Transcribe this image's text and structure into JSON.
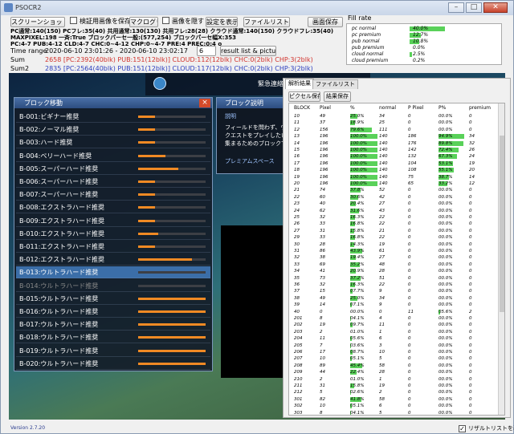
{
  "window": {
    "title": "PSOCR2",
    "min": "–",
    "max": "□",
    "close": "✕"
  },
  "toolbar": {
    "screenshot_btn": "スクリーンショット解析",
    "save_check": "検証用画像を保存",
    "macro_btn": "マクログリア",
    "hide_check": "画像を隠す",
    "settings_btn": "設定を表示",
    "clear_btn": "ファイルリストをクリア",
    "save_img_btn": "画面保存"
  },
  "info_lines": [
    "PC通常:140(150) PCフレ:35(40) 共用通常:130(130) 共用フレ:28(28) クラウド通常:140(150) クラウドフレ:35(40)",
    "MAXPIXEL:198 一斉:True ブロックパーセ一般:(577,254) ブロックパーセ幅X:353",
    "PC:4-7 PUB:4-12 CLD:4-7 CHC:0~4-12 CHP:0~4-7 PRE:4 PREC:0:4 o"
  ],
  "time_range": {
    "label": "Time range",
    "value": "2020-06-10 23:01:26 - 2020-06-10 23:02:17",
    "count": "6",
    "button": "result list & picture"
  },
  "sum": {
    "label": "Sum",
    "value": "2658 [PC:2392(40blk) PUB:151(12blk)] CLOUD:112(12blk) CHC:0(2blk) CHP:3(2blk)"
  },
  "sum2": {
    "label": "Sum2",
    "value": "2835 [PC:2564(40blk) PUB:151(12blk)] CLOUD:117(12blk) CHC:0(2blk) CHP:3(2blk)"
  },
  "fill_rate": {
    "title": "Fill rate",
    "rows": [
      {
        "name": "pc normal",
        "value": "40.0%",
        "fill": 0.4
      },
      {
        "name": "pc premium",
        "value": "12.7%",
        "fill": 0.127
      },
      {
        "name": "pub normal",
        "value": "10.8%",
        "fill": 0.108
      },
      {
        "name": "pub premium",
        "value": "0.0%",
        "fill": 0.0
      },
      {
        "name": "cloud normal",
        "value": "2.5%",
        "fill": 0.025
      },
      {
        "name": "cloud premium",
        "value": "0.2%",
        "fill": 0.002
      }
    ]
  },
  "block_window": {
    "title": "ブロック移動",
    "rows": [
      {
        "name": "B-001:ビギナー推奨",
        "bar": 0.25
      },
      {
        "name": "B-002:ノーマル推奨",
        "bar": 0.25
      },
      {
        "name": "B-003:ハード推奨",
        "bar": 0.25
      },
      {
        "name": "B-004:ベリーハード推奨",
        "bar": 0.4
      },
      {
        "name": "B-005:スーパーハード推奨",
        "bar": 0.6
      },
      {
        "name": "B-006:スーパーハード推奨",
        "bar": 0.25
      },
      {
        "name": "B-007:スーパーハード推奨",
        "bar": 0.25
      },
      {
        "name": "B-008:エクストラハード推奨",
        "bar": 0.25
      },
      {
        "name": "B-009:エクストラハード推奨",
        "bar": 0.25
      },
      {
        "name": "B-010:エクストラハード推奨",
        "bar": 0.3
      },
      {
        "name": "B-011:エクストラハード推奨",
        "bar": 0.25
      },
      {
        "name": "B-012:エクストラハード推奨",
        "bar": 0.8
      },
      {
        "name": "B-013:ウルトラハード推奨",
        "bar": 0.0
      },
      {
        "name": "B-014:ウルトラハード推奨",
        "bar": 0.0
      },
      {
        "name": "B-015:ウルトラハード推奨",
        "bar": 1.0
      },
      {
        "name": "B-016:ウルトラハード推奨",
        "bar": 1.0
      },
      {
        "name": "B-017:ウルトラハード推奨",
        "bar": 1.0
      },
      {
        "name": "B-018:ウルトラハード推奨",
        "bar": 1.0
      },
      {
        "name": "B-019:ウルトラハード推奨",
        "bar": 1.0
      },
      {
        "name": "B-020:ウルトラハード推奨",
        "bar": 1.0
      }
    ]
  },
  "explain_window": {
    "title": "ブロック説明",
    "section": "説明",
    "lines": [
      "フィールドを問わず、ウル",
      "クエストをプレイしたい",
      "集まるためのブロックで"
    ],
    "footer": "プレミアムスペース"
  },
  "hud": {
    "urgent": "緊急連絡"
  },
  "result_panel": {
    "tab1": "解析結果",
    "tab2": "ファイルリスト",
    "clip_btn": "ピクセル保存",
    "save_btn": "結果保存",
    "headers": [
      "BLOCK",
      "Pixel",
      "%",
      "normal",
      "P Pixel",
      "P%",
      "premium"
    ],
    "rows": [
      [
        "10",
        "49",
        "25.0%",
        "34",
        "0",
        "00.0%",
        "0"
      ],
      [
        "11",
        "37",
        "18.9%",
        "25",
        "0",
        "00.0%",
        "0"
      ],
      [
        "12",
        "156",
        "79.6%",
        "111",
        "0",
        "00.0%",
        "0"
      ],
      [
        "13",
        "196",
        "100.0%",
        "140",
        "186",
        "94.9%",
        "34"
      ],
      [
        "14",
        "196",
        "100.0%",
        "140",
        "176",
        "89.8%",
        "32"
      ],
      [
        "15",
        "196",
        "100.0%",
        "140",
        "142",
        "72.4%",
        "26"
      ],
      [
        "16",
        "196",
        "100.0%",
        "140",
        "132",
        "67.3%",
        "24"
      ],
      [
        "17",
        "196",
        "100.0%",
        "140",
        "104",
        "53.1%",
        "19"
      ],
      [
        "18",
        "196",
        "100.0%",
        "140",
        "108",
        "55.1%",
        "20"
      ],
      [
        "19",
        "196",
        "100.0%",
        "140",
        "75",
        "38.7%",
        "14"
      ],
      [
        "20",
        "196",
        "100.0%",
        "140",
        "65",
        "33.2%",
        "12"
      ],
      [
        "21",
        "74",
        "37.8%",
        "52",
        "0",
        "00.0%",
        "0"
      ],
      [
        "22",
        "60",
        "30.6%",
        "42",
        "0",
        "00.0%",
        "0"
      ],
      [
        "23",
        "40",
        "20.4%",
        "27",
        "0",
        "00.0%",
        "0"
      ],
      [
        "24",
        "62",
        "31.6%",
        "43",
        "0",
        "00.0%",
        "0"
      ],
      [
        "25",
        "32",
        "16.3%",
        "22",
        "0",
        "00.0%",
        "0"
      ],
      [
        "26",
        "33",
        "16.8%",
        "22",
        "0",
        "00.0%",
        "0"
      ],
      [
        "27",
        "31",
        "15.8%",
        "21",
        "0",
        "00.0%",
        "0"
      ],
      [
        "29",
        "33",
        "16.8%",
        "22",
        "0",
        "00.0%",
        "0"
      ],
      [
        "30",
        "28",
        "14.3%",
        "19",
        "0",
        "00.0%",
        "0"
      ],
      [
        "31",
        "86",
        "43.9%",
        "61",
        "0",
        "00.0%",
        "0"
      ],
      [
        "32",
        "38",
        "19.4%",
        "27",
        "0",
        "00.0%",
        "0"
      ],
      [
        "33",
        "69",
        "35.2%",
        "48",
        "0",
        "00.0%",
        "0"
      ],
      [
        "34",
        "41",
        "20.9%",
        "28",
        "0",
        "00.0%",
        "0"
      ],
      [
        "35",
        "73",
        "37.2%",
        "51",
        "0",
        "00.0%",
        "0"
      ],
      [
        "36",
        "32",
        "16.3%",
        "22",
        "0",
        "00.0%",
        "0"
      ],
      [
        "37",
        "15",
        "07.7%",
        "9",
        "0",
        "00.0%",
        "0"
      ],
      [
        "38",
        "49",
        "25.0%",
        "34",
        "0",
        "00.0%",
        "0"
      ],
      [
        "39",
        "14",
        "07.1%",
        "9",
        "0",
        "00.0%",
        "0"
      ],
      [
        "40",
        "0",
        "00.0%",
        "0",
        "11",
        "05.6%",
        "2"
      ],
      [
        "201",
        "8",
        "04.1%",
        "4",
        "0",
        "00.0%",
        "0"
      ],
      [
        "202",
        "19",
        "09.7%",
        "11",
        "0",
        "00.0%",
        "0"
      ],
      [
        "203",
        "2",
        "01.0%",
        "1",
        "0",
        "00.0%",
        "0"
      ],
      [
        "204",
        "11",
        "05.6%",
        "6",
        "0",
        "00.0%",
        "0"
      ],
      [
        "205",
        "7",
        "03.6%",
        "3",
        "0",
        "00.0%",
        "0"
      ],
      [
        "206",
        "17",
        "08.7%",
        "10",
        "0",
        "00.0%",
        "0"
      ],
      [
        "207",
        "10",
        "05.1%",
        "5",
        "0",
        "00.0%",
        "0"
      ],
      [
        "208",
        "89",
        "45.4%",
        "58",
        "0",
        "00.0%",
        "0"
      ],
      [
        "209",
        "44",
        "22.4%",
        "28",
        "0",
        "00.0%",
        "0"
      ],
      [
        "210",
        "2",
        "01.0%",
        "1",
        "0",
        "00.0%",
        "0"
      ],
      [
        "211",
        "31",
        "15.8%",
        "19",
        "0",
        "00.0%",
        "0"
      ],
      [
        "212",
        "5",
        "02.6%",
        "2",
        "0",
        "00.0%",
        "0"
      ],
      [
        "301",
        "82",
        "41.8%",
        "58",
        "0",
        "00.0%",
        "0"
      ],
      [
        "302",
        "10",
        "05.1%",
        "6",
        "0",
        "00.0%",
        "0"
      ],
      [
        "303",
        "8",
        "04.1%",
        "5",
        "0",
        "00.0%",
        "0"
      ]
    ]
  },
  "footer": {
    "version": "Version 2.7.20",
    "show_result": "リザルトリストを表示"
  }
}
